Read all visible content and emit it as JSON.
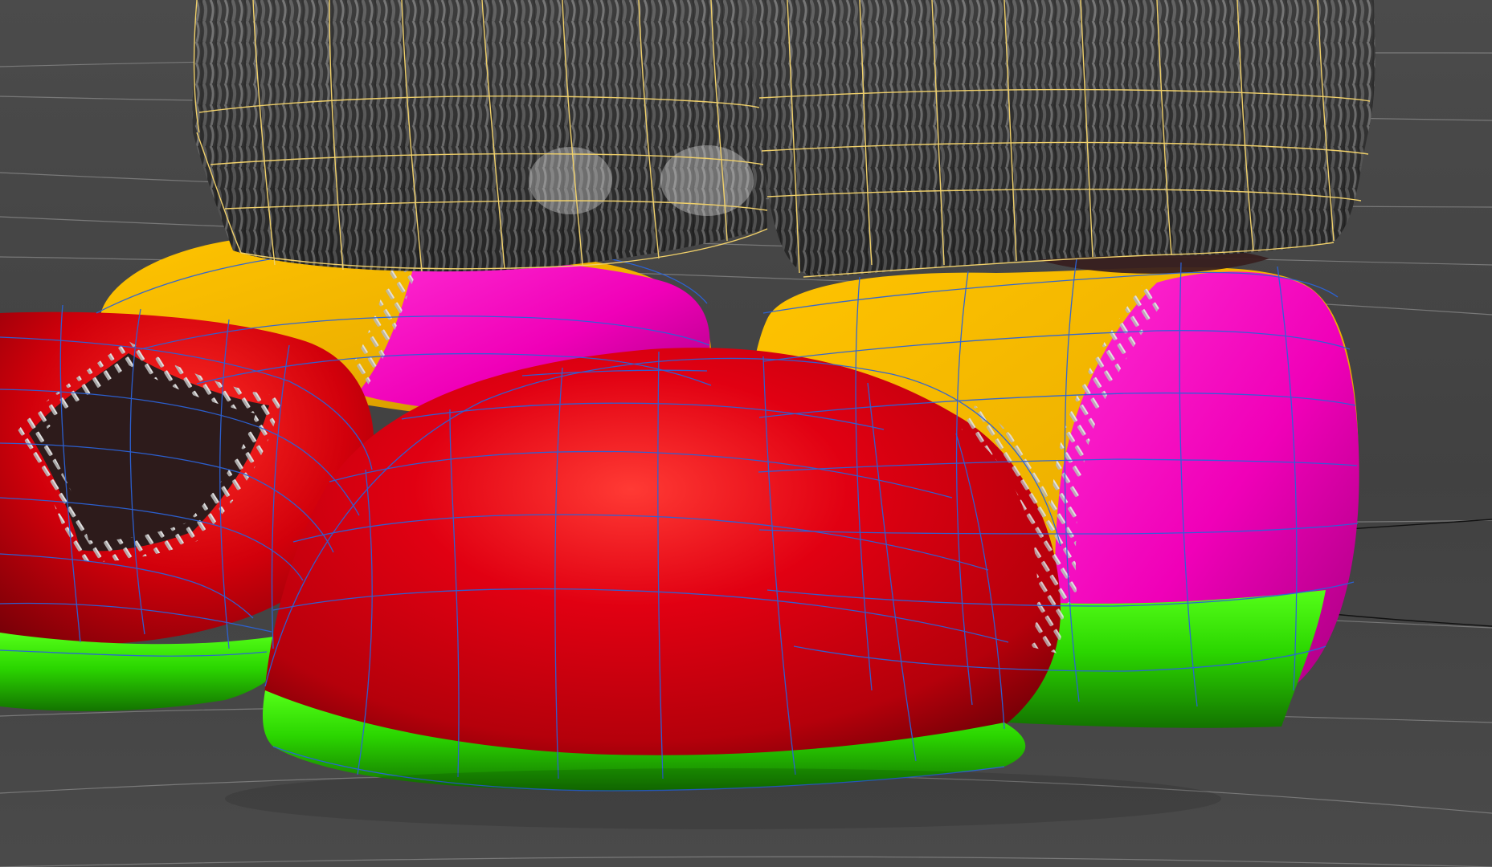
{
  "scene": {
    "background": "#474747",
    "grid_color": "#8a8a8a",
    "pant_wire_color": "#f0d06a",
    "shoe_wire_color": "#2b63d8",
    "colors": {
      "red": "#d7000c",
      "magenta": "#ff12c8",
      "yellow": "#f3b400",
      "green": "#2ed800",
      "patch": "#2c1b1b",
      "pants": "#2d2d2d"
    }
  }
}
